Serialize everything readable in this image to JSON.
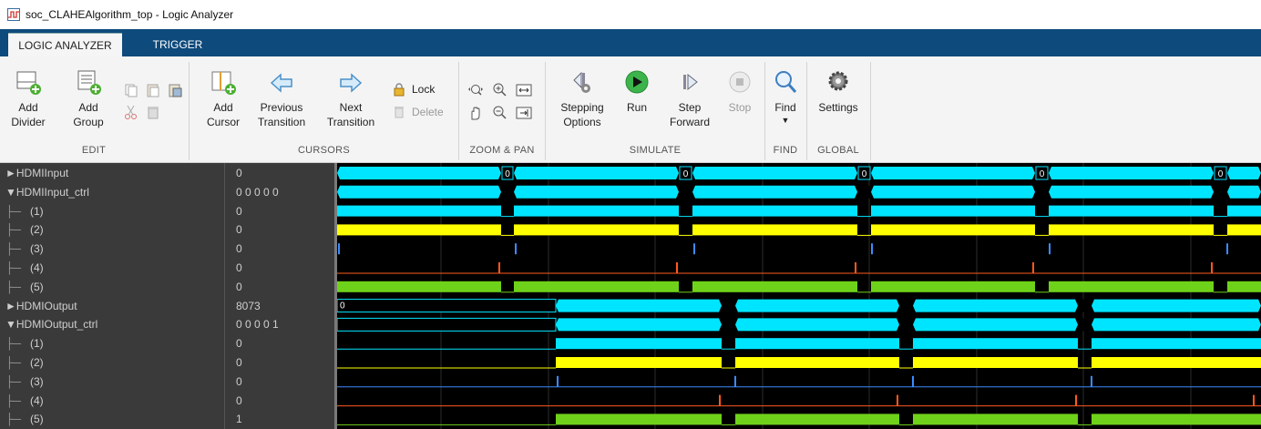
{
  "window": {
    "title": "soc_CLAHEAlgorithm_top - Logic Analyzer"
  },
  "tabs": [
    {
      "label": "LOGIC ANALYZER",
      "active": true
    },
    {
      "label": "TRIGGER",
      "active": false
    }
  ],
  "toolstrip": {
    "edit": {
      "add_divider": "Add\nDivider",
      "add_group": "Add\nGroup",
      "section": "EDIT"
    },
    "cursors": {
      "add_cursor": "Add\nCursor",
      "previous_transition": "Previous\nTransition",
      "next_transition": "Next\nTransition",
      "lock": "Lock",
      "delete": "Delete",
      "section": "CURSORS"
    },
    "zoom_pan": {
      "section": "ZOOM & PAN"
    },
    "simulate": {
      "stepping_options": "Stepping\nOptions",
      "run": "Run",
      "step_forward": "Step\nForward",
      "stop": "Stop",
      "section": "SIMULATE"
    },
    "find": {
      "label": "Find",
      "section": "FIND"
    },
    "global": {
      "settings": "Settings",
      "section": "GLOBAL"
    }
  },
  "signals": [
    {
      "name": "►HDMIInput",
      "value": "0"
    },
    {
      "name": "▼HDMIInput_ctrl",
      "value": "0 0 0 0 0"
    },
    {
      "name": "(1)",
      "value": "0"
    },
    {
      "name": "(2)",
      "value": "0"
    },
    {
      "name": "(3)",
      "value": "0"
    },
    {
      "name": "(4)",
      "value": "0"
    },
    {
      "name": "(5)",
      "value": "0"
    },
    {
      "name": "►HDMIOutput",
      "value": "8073"
    },
    {
      "name": "▼HDMIOutput_ctrl",
      "value": "0 0 0 0 1"
    },
    {
      "name": "(1)",
      "value": "0"
    },
    {
      "name": "(2)",
      "value": "0"
    },
    {
      "name": "(3)",
      "value": "0"
    },
    {
      "name": "(4)",
      "value": "0"
    },
    {
      "name": "(5)",
      "value": "1"
    }
  ],
  "bus_markers": {
    "input": "0",
    "output": "0"
  },
  "colors": {
    "cyan": "#00e5ff",
    "yellow": "#ffff00",
    "blue": "#3b8cff",
    "orange": "#ff5a1f",
    "green": "#6fd21a",
    "tab_bar": "#0e4a7c"
  }
}
